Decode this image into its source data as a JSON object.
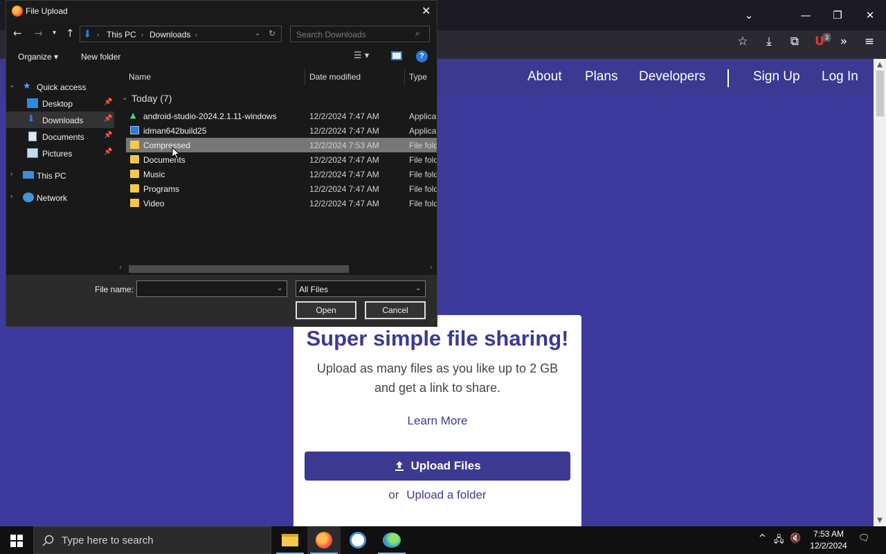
{
  "browser": {
    "window_controls": {
      "tabs_list": "⌄",
      "minimize": "—",
      "restore": "❐",
      "close": "✕"
    },
    "toolbar": {
      "bookmark": "☆",
      "downloads": "⤓",
      "extensions": "⧉",
      "ublock": "U",
      "ublock_count": "3",
      "overflow": "»",
      "menu": "≡"
    }
  },
  "site": {
    "nav": {
      "about": "About",
      "plans": "Plans",
      "developers": "Developers",
      "signup": "Sign Up",
      "login": "Log In"
    },
    "card": {
      "title": "Super simple file sharing!",
      "subtitle_line1": "Upload as many files as you like up to 2 GB",
      "subtitle_line2": "and get a link to share.",
      "learn_more": "Learn More",
      "upload_button": "Upload Files",
      "or_text": "or",
      "upload_folder": "Upload a folder"
    }
  },
  "dialog": {
    "title": "File Upload",
    "breadcrumb": [
      "This PC",
      "Downloads"
    ],
    "search_placeholder": "Search Downloads",
    "commands": {
      "organize": "Organize ▾",
      "new_folder": "New folder"
    },
    "nav_pane": {
      "quick_access": "Quick access",
      "items": [
        {
          "label": "Desktop",
          "pinned": true
        },
        {
          "label": "Downloads",
          "pinned": true,
          "selected": true
        },
        {
          "label": "Documents",
          "pinned": true
        },
        {
          "label": "Pictures",
          "pinned": true
        }
      ],
      "this_pc": "This PC",
      "network": "Network"
    },
    "columns": {
      "name": "Name",
      "date": "Date modified",
      "type": "Type"
    },
    "group_header": "Today (7)",
    "files": [
      {
        "name": "android-studio-2024.2.1.11-windows",
        "date": "12/2/2024 7:47 AM",
        "type": "Applicat",
        "icon": "android-icon"
      },
      {
        "name": "idman642build25",
        "date": "12/2/2024 7:47 AM",
        "type": "Applicat",
        "icon": "idm-icon"
      },
      {
        "name": "Compressed",
        "date": "12/2/2024 7:53 AM",
        "type": "File fold",
        "icon": "folder-icon",
        "selected": true
      },
      {
        "name": "Documents",
        "date": "12/2/2024 7:47 AM",
        "type": "File fold",
        "icon": "folder-icon"
      },
      {
        "name": "Music",
        "date": "12/2/2024 7:47 AM",
        "type": "File fold",
        "icon": "folder-icon"
      },
      {
        "name": "Programs",
        "date": "12/2/2024 7:47 AM",
        "type": "File fold",
        "icon": "folder-icon"
      },
      {
        "name": "Video",
        "date": "12/2/2024 7:47 AM",
        "type": "File fold",
        "icon": "folder-icon"
      }
    ],
    "file_name_label": "File name:",
    "file_name_value": "",
    "file_type": "All Files",
    "open_button": "Open",
    "cancel_button": "Cancel"
  },
  "taskbar": {
    "search_placeholder": "Type here to search",
    "time": "7:53 AM",
    "date": "12/2/2024"
  },
  "colors": {
    "site_bg": "#3d3a9e",
    "brand": "#3b3991",
    "dialog_bg": "#191919",
    "selection": "#777777"
  }
}
